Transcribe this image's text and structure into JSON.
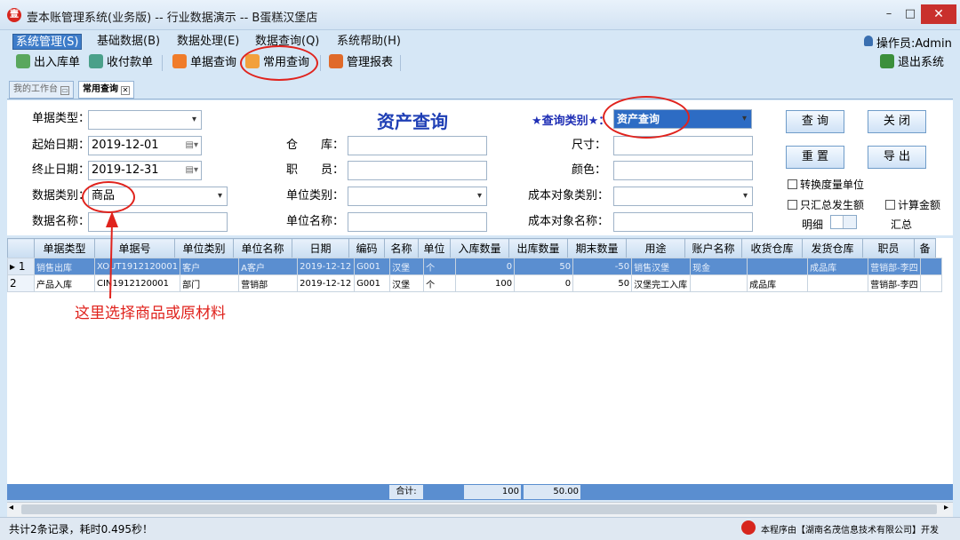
{
  "window": {
    "title": "壹本账管理系统(业务版) -- 行业数据演示 -- B蛋糕汉堡店",
    "min": "–",
    "max": "□",
    "close": "✕"
  },
  "menu": [
    "系统管理(S)",
    "基础数据(B)",
    "数据处理(E)",
    "数据查询(Q)",
    "系统帮助(H)"
  ],
  "operator": "操作员:Admin",
  "toolbar": {
    "inout": "出入库单",
    "payment": "收付款单",
    "docquery": "单据查询",
    "common": "常用查询",
    "report": "管理报表",
    "exit": "退出系统"
  },
  "tabs": {
    "workbench": "我的工作台",
    "common": "常用查询"
  },
  "form": {
    "title": "资产查询",
    "doc_type_label": "单据类型：",
    "doc_type_value": "",
    "start_label": "起始日期：",
    "start_value": "2019-12-01",
    "end_label": "终止日期：",
    "end_value": "2019-12-31",
    "data_cat_label": "数据类别：",
    "data_cat_value": "商品",
    "data_name_label": "数据名称：",
    "data_name_value": "",
    "warehouse_label": "仓　　库：",
    "staff_label": "职　　员：",
    "unit_cat_label": "单位类别：",
    "unit_name_label": "单位名称：",
    "query_type_label": "★查询类别★：",
    "query_type_value": "资产查询",
    "size_label": "尺寸：",
    "color_label": "颜色：",
    "cost_cat_label": "成本对象类别：",
    "cost_name_label": "成本对象名称："
  },
  "buttons": {
    "query": "查 询",
    "close": "关 闭",
    "reset": "重 置",
    "export": "导 出"
  },
  "options": {
    "convert_unit": "转换度量单位",
    "only_summary": "只汇总发生额",
    "calc_amount": "计算金额",
    "detail": "明细",
    "summary": "汇总"
  },
  "grid": {
    "columns": [
      "",
      "单据类型",
      "单据号",
      "单位类别",
      "单位名称",
      "日期",
      "编码",
      "名称",
      "单位",
      "入库数量",
      "出库数量",
      "期末数量",
      "用途",
      "账户名称",
      "收货仓库",
      "发货仓库",
      "职员",
      "备"
    ],
    "rows": [
      [
        "▸ 1",
        "销售出库",
        "XOUT1912120001",
        "客户",
        "A客户",
        "2019-12-12",
        "G001",
        "汉堡",
        "个",
        "0",
        "50",
        "-50",
        "销售汉堡",
        "现金",
        "",
        "成品库",
        "营销部-李四",
        ""
      ],
      [
        "2",
        "产品入库",
        "CIN1912120001",
        "部门",
        "营销部",
        "2019-12-12",
        "G001",
        "汉堡",
        "个",
        "100",
        "0",
        "50",
        "汉堡完工入库",
        "",
        "成品库",
        "",
        "营销部-李四",
        ""
      ]
    ],
    "total_label": "合计:",
    "total_in": "100",
    "total_out": "50.00"
  },
  "status": {
    "records": "共计2条记录，耗时0.495秒！",
    "vendor": "本程序由【湖南名茂信息技术有限公司】开发"
  },
  "annotation": "这里选择商品或原材料",
  "colors": {
    "accent": "#2d6cc4",
    "annotation": "#e0231d",
    "title": "#1f3fb5"
  }
}
